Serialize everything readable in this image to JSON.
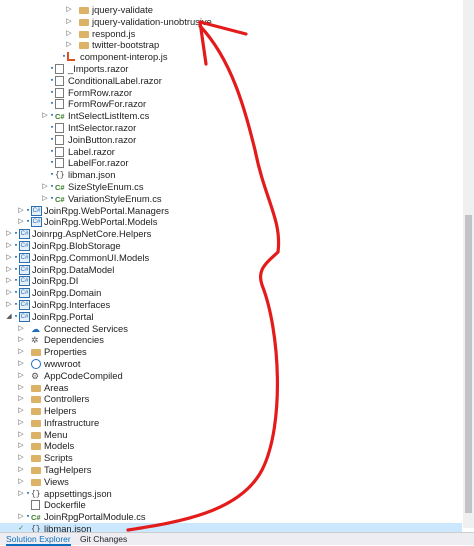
{
  "tree": [
    {
      "label": "jquery-validate",
      "depth": 6,
      "icon": "folder",
      "twisty": "collapsed"
    },
    {
      "label": "jquery-validation-unobtrusive",
      "depth": 6,
      "icon": "folder",
      "twisty": "collapsed"
    },
    {
      "label": "respond.js",
      "depth": 6,
      "icon": "folder",
      "twisty": "collapsed"
    },
    {
      "label": "twitter-bootstrap",
      "depth": 6,
      "icon": "folder",
      "twisty": "collapsed"
    },
    {
      "label": "component-interop.js",
      "depth": 5,
      "icon": "interop",
      "lock": true
    },
    {
      "label": "_Imports.razor",
      "depth": 4,
      "icon": "file",
      "lock": true
    },
    {
      "label": "ConditionalLabel.razor",
      "depth": 4,
      "icon": "file",
      "lock": true
    },
    {
      "label": "FormRow.razor",
      "depth": 4,
      "icon": "file",
      "lock": true
    },
    {
      "label": "FormRowFor.razor",
      "depth": 4,
      "icon": "file",
      "lock": true
    },
    {
      "label": "IntSelectListItem.cs",
      "depth": 4,
      "icon": "cs",
      "lock": true,
      "twisty": "collapsed"
    },
    {
      "label": "IntSelector.razor",
      "depth": 4,
      "icon": "file",
      "lock": true
    },
    {
      "label": "JoinButton.razor",
      "depth": 4,
      "icon": "file",
      "lock": true
    },
    {
      "label": "Label.razor",
      "depth": 4,
      "icon": "file",
      "lock": true
    },
    {
      "label": "LabelFor.razor",
      "depth": 4,
      "icon": "file",
      "lock": true
    },
    {
      "label": "libman.json",
      "depth": 4,
      "icon": "json",
      "lock": true
    },
    {
      "label": "SizeStyleEnum.cs",
      "depth": 4,
      "icon": "cs",
      "lock": true,
      "twisty": "collapsed"
    },
    {
      "label": "VariationStyleEnum.cs",
      "depth": 4,
      "icon": "cs",
      "lock": true,
      "twisty": "collapsed"
    },
    {
      "label": "JoinRpg.WebPortal.Managers",
      "depth": 2,
      "icon": "project",
      "lock": true,
      "twisty": "collapsed"
    },
    {
      "label": "JoinRpg.WebPortal.Models",
      "depth": 2,
      "icon": "project",
      "lock": true,
      "twisty": "collapsed"
    },
    {
      "label": "Joinrpg.AspNetCore.Helpers",
      "depth": 1,
      "icon": "project",
      "lock": true,
      "twisty": "collapsed"
    },
    {
      "label": "JoinRpg.BlobStorage",
      "depth": 1,
      "icon": "project",
      "lock": true,
      "twisty": "collapsed"
    },
    {
      "label": "JoinRpg.CommonUI.Models",
      "depth": 1,
      "icon": "project",
      "lock": true,
      "twisty": "collapsed"
    },
    {
      "label": "JoinRpg.DataModel",
      "depth": 1,
      "icon": "project",
      "lock": true,
      "twisty": "collapsed"
    },
    {
      "label": "JoinRpg.DI",
      "depth": 1,
      "icon": "project",
      "lock": true,
      "twisty": "collapsed"
    },
    {
      "label": "JoinRpg.Domain",
      "depth": 1,
      "icon": "project",
      "lock": true,
      "twisty": "collapsed"
    },
    {
      "label": "JoinRpg.Interfaces",
      "depth": 1,
      "icon": "project",
      "lock": true,
      "twisty": "collapsed"
    },
    {
      "label": "JoinRpg.Portal",
      "depth": 1,
      "icon": "project",
      "lock": true,
      "twisty": "expanded"
    },
    {
      "label": "Connected Services",
      "depth": 2,
      "icon": "connected",
      "twisty": "collapsed"
    },
    {
      "label": "Dependencies",
      "depth": 2,
      "icon": "dependencies",
      "twisty": "collapsed"
    },
    {
      "label": "Properties",
      "depth": 2,
      "icon": "folder",
      "twisty": "collapsed"
    },
    {
      "label": "wwwroot",
      "depth": 2,
      "icon": "web",
      "twisty": "collapsed"
    },
    {
      "label": "AppCodeCompiled",
      "depth": 2,
      "icon": "gear",
      "twisty": "collapsed"
    },
    {
      "label": "Areas",
      "depth": 2,
      "icon": "folder",
      "twisty": "collapsed"
    },
    {
      "label": "Controllers",
      "depth": 2,
      "icon": "folder",
      "twisty": "collapsed"
    },
    {
      "label": "Helpers",
      "depth": 2,
      "icon": "folder",
      "twisty": "collapsed"
    },
    {
      "label": "Infrastructure",
      "depth": 2,
      "icon": "folder",
      "twisty": "collapsed"
    },
    {
      "label": "Menu",
      "depth": 2,
      "icon": "folder",
      "twisty": "collapsed"
    },
    {
      "label": "Models",
      "depth": 2,
      "icon": "folder",
      "twisty": "collapsed"
    },
    {
      "label": "Scripts",
      "depth": 2,
      "icon": "folder",
      "twisty": "collapsed"
    },
    {
      "label": "TagHelpers",
      "depth": 2,
      "icon": "folder",
      "twisty": "collapsed"
    },
    {
      "label": "Views",
      "depth": 2,
      "icon": "folder",
      "twisty": "collapsed"
    },
    {
      "label": "appsettings.json",
      "depth": 2,
      "icon": "json",
      "lock": true,
      "twisty": "collapsed"
    },
    {
      "label": "Dockerfile",
      "depth": 2,
      "icon": "dockerfile"
    },
    {
      "label": "JoinRpgPortalModule.cs",
      "depth": 2,
      "icon": "cs",
      "lock": true,
      "twisty": "collapsed"
    },
    {
      "label": "libman.json",
      "depth": 2,
      "icon": "json",
      "lock": false,
      "selected": true,
      "checkmark": true
    }
  ],
  "tabs": [
    {
      "label": "Solution Explorer",
      "active": true
    },
    {
      "label": "Git Changes",
      "active": false
    }
  ],
  "colors": {
    "annotation": "#e31b1b",
    "selection": "#cce8ff",
    "accent": "#0e70c0"
  }
}
